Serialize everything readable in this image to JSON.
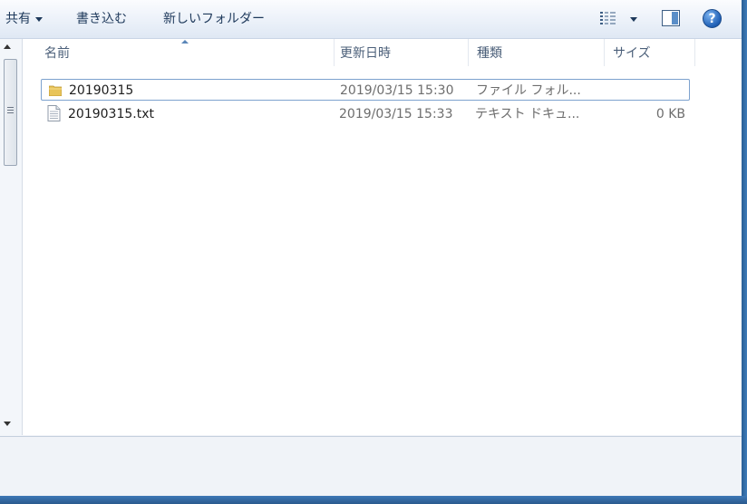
{
  "toolbar": {
    "share_label": "共有",
    "burn_label": "書き込む",
    "new_folder_label": "新しいフォルダー",
    "help_label": "?"
  },
  "columns": {
    "name": "名前",
    "date": "更新日時",
    "type": "種類",
    "size": "サイズ"
  },
  "files": [
    {
      "name": "20190315",
      "date": "2019/03/15 15:30",
      "type": "ファイル フォル...",
      "size": "",
      "icon": "folder-icon"
    },
    {
      "name": "20190315.txt",
      "date": "2019/03/15 15:33",
      "type": "テキスト ドキュ...",
      "size": "0 KB",
      "icon": "text-file-icon"
    }
  ],
  "colors": {
    "accent": "#1f5fb5",
    "selection_border": "#7da2ce",
    "folder": "#e8c45a"
  }
}
